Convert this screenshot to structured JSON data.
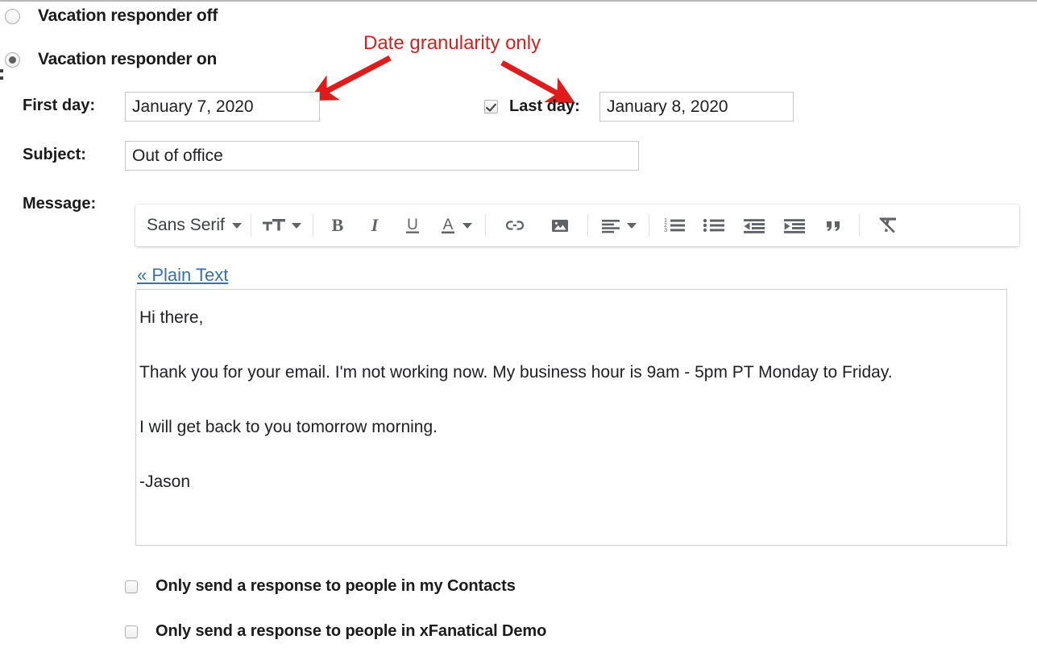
{
  "annotation": {
    "text": "Date granularity only",
    "color": "#d42222"
  },
  "responder": {
    "off_label": "Vacation responder off",
    "on_label": "Vacation responder on",
    "selected": "on"
  },
  "first_day": {
    "label": "First day:",
    "value": "January 7, 2020"
  },
  "last_day": {
    "label": "Last day:",
    "value": "January 8, 2020",
    "checkbox_checked": true
  },
  "subject": {
    "label": "Subject:",
    "value": "Out of office"
  },
  "message": {
    "label": "Message:",
    "plain_text_link": "« Plain Text",
    "toolbar": {
      "font_name": "Sans Serif",
      "items": [
        "font-family-dropdown",
        "font-size-dropdown",
        "bold",
        "italic",
        "underline",
        "text-color",
        "insert-link",
        "insert-image",
        "align",
        "numbered-list",
        "bulleted-list",
        "indent-less",
        "indent-more",
        "quote",
        "remove-formatting"
      ]
    },
    "body_lines": [
      "Hi there,",
      "Thank you for your email. I'm not working now. My business hour is 9am - 5pm PT Monday to Friday.",
      "I will get back to you tomorrow morning.",
      "-Jason"
    ]
  },
  "options": [
    {
      "label": "Only send a response to people in my Contacts",
      "checked": false
    },
    {
      "label": "Only send a response to people in xFanatical Demo",
      "checked": false
    }
  ]
}
